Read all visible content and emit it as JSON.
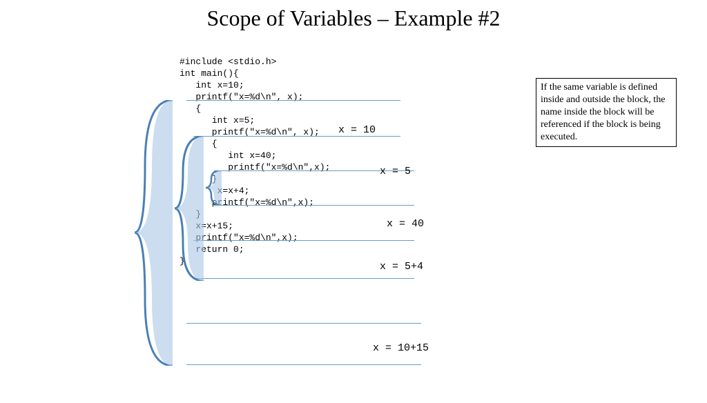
{
  "title": "Scope of Variables – Example #2",
  "code": "#include <stdio.h>\nint main(){\n   int x=10;\n   printf(\"x=%d\\n\", x);\n   {\n      int x=5;\n      printf(\"x=%d\\n\", x);\n      {\n         int x=40;\n         printf(\"x=%d\\n\",x);\n      }\n       x=x+4;\n      printf(\"x=%d\\n\",x);\n   }\n   x=x+15;\n   printf(\"x=%d\\n\",x);\n   return 0;\n}",
  "infobox": "If the same variable is defined inside and outside the block, the name inside the block will be referenced if the block is being executed.",
  "outputs": {
    "o1": "x = 10",
    "o2": "x = 5",
    "o3": "x = 40",
    "o4": "x = 5+4",
    "o5": "x = 10+15"
  }
}
